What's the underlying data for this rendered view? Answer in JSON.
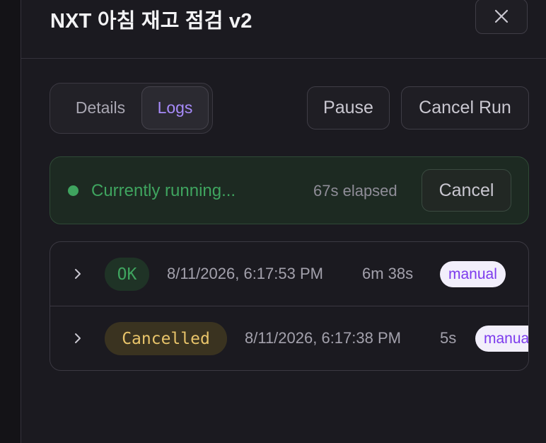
{
  "header": {
    "title": "NXT 아침 재고 점검 v2",
    "close_icon": "close-icon"
  },
  "tabs": [
    {
      "label": "Details",
      "active": false
    },
    {
      "label": "Logs",
      "active": true
    }
  ],
  "actions": {
    "pause_label": "Pause",
    "cancel_run_label": "Cancel Run"
  },
  "running": {
    "status_text": "Currently running...",
    "elapsed": "67s elapsed",
    "cancel_label": "Cancel"
  },
  "runs": [
    {
      "status": "OK",
      "timestamp": "8/11/2026, 6:17:53 PM",
      "duration": "6m 38s",
      "trigger": "manual"
    },
    {
      "status": "Cancelled",
      "timestamp": "8/11/2026, 6:17:38 PM",
      "duration": "5s",
      "trigger": "manual"
    }
  ],
  "colors": {
    "accent": "#a78bfa",
    "running_green": "#3fa45f",
    "ok_bg": "#1f3326",
    "cancelled_text": "#e8c46a",
    "cancelled_bg": "#3a3320",
    "tag_bg": "#f2effb",
    "tag_text": "#7c3aed"
  }
}
